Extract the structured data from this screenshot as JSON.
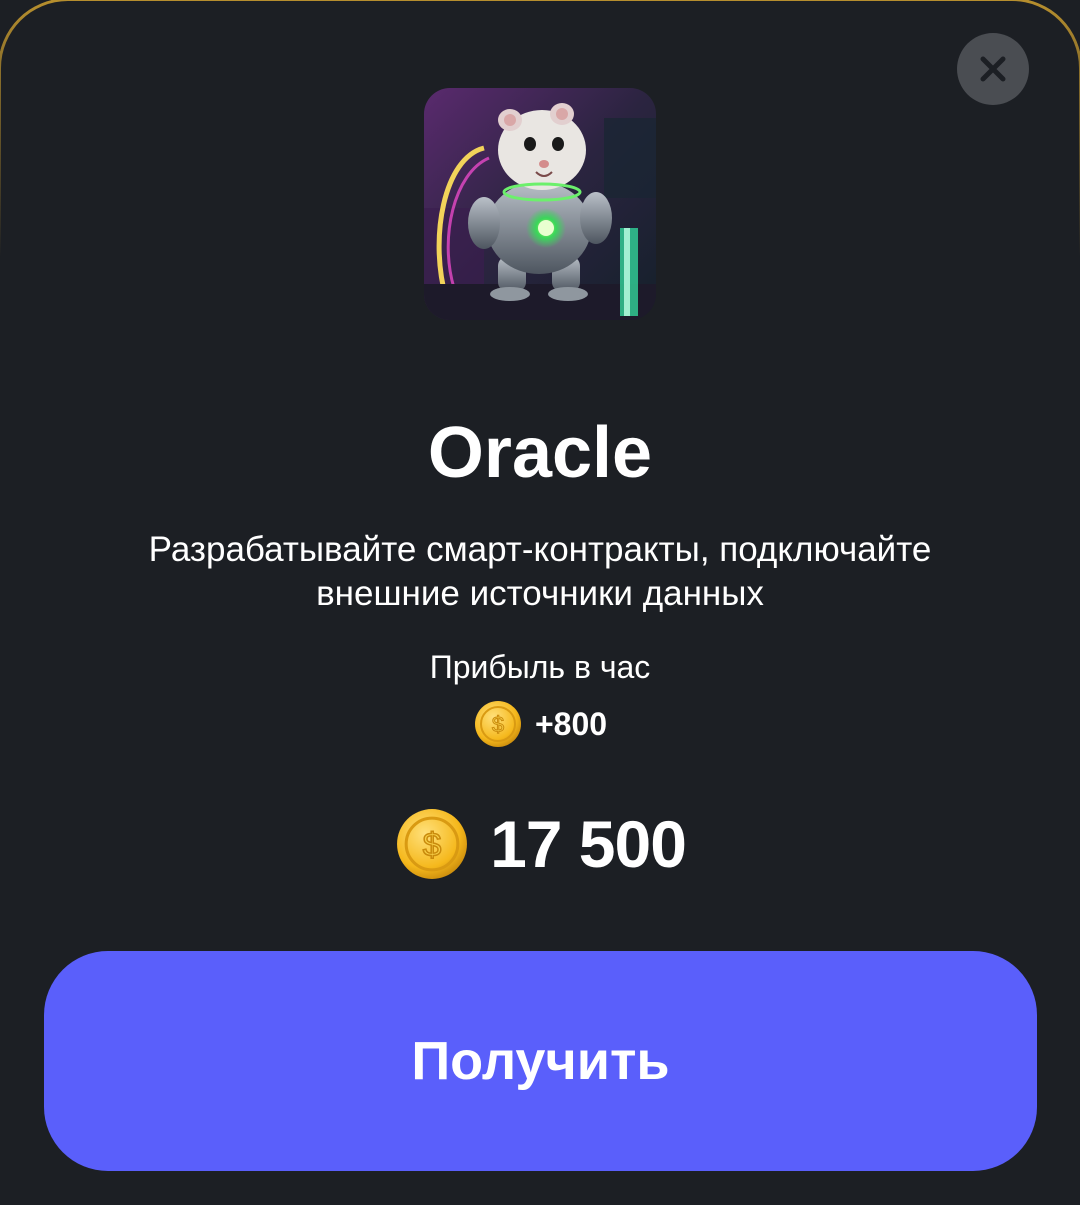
{
  "modal": {
    "close_icon": "close-icon",
    "card_image": "hamster-robot-illustration",
    "title": "Oracle",
    "description": "Разрабатывайте смарт-контракты, подключайте внешние источники данных",
    "profit_label": "Прибыль в час",
    "profit_icon": "coin-icon",
    "profit_value": "+800",
    "price_icon": "coin-icon",
    "price_value": "17 500",
    "get_button_label": "Получить"
  },
  "colors": {
    "background": "#1c1f24",
    "accent": "#5a5ffb",
    "coin": "#f5b81c",
    "border": "#b8902e"
  }
}
